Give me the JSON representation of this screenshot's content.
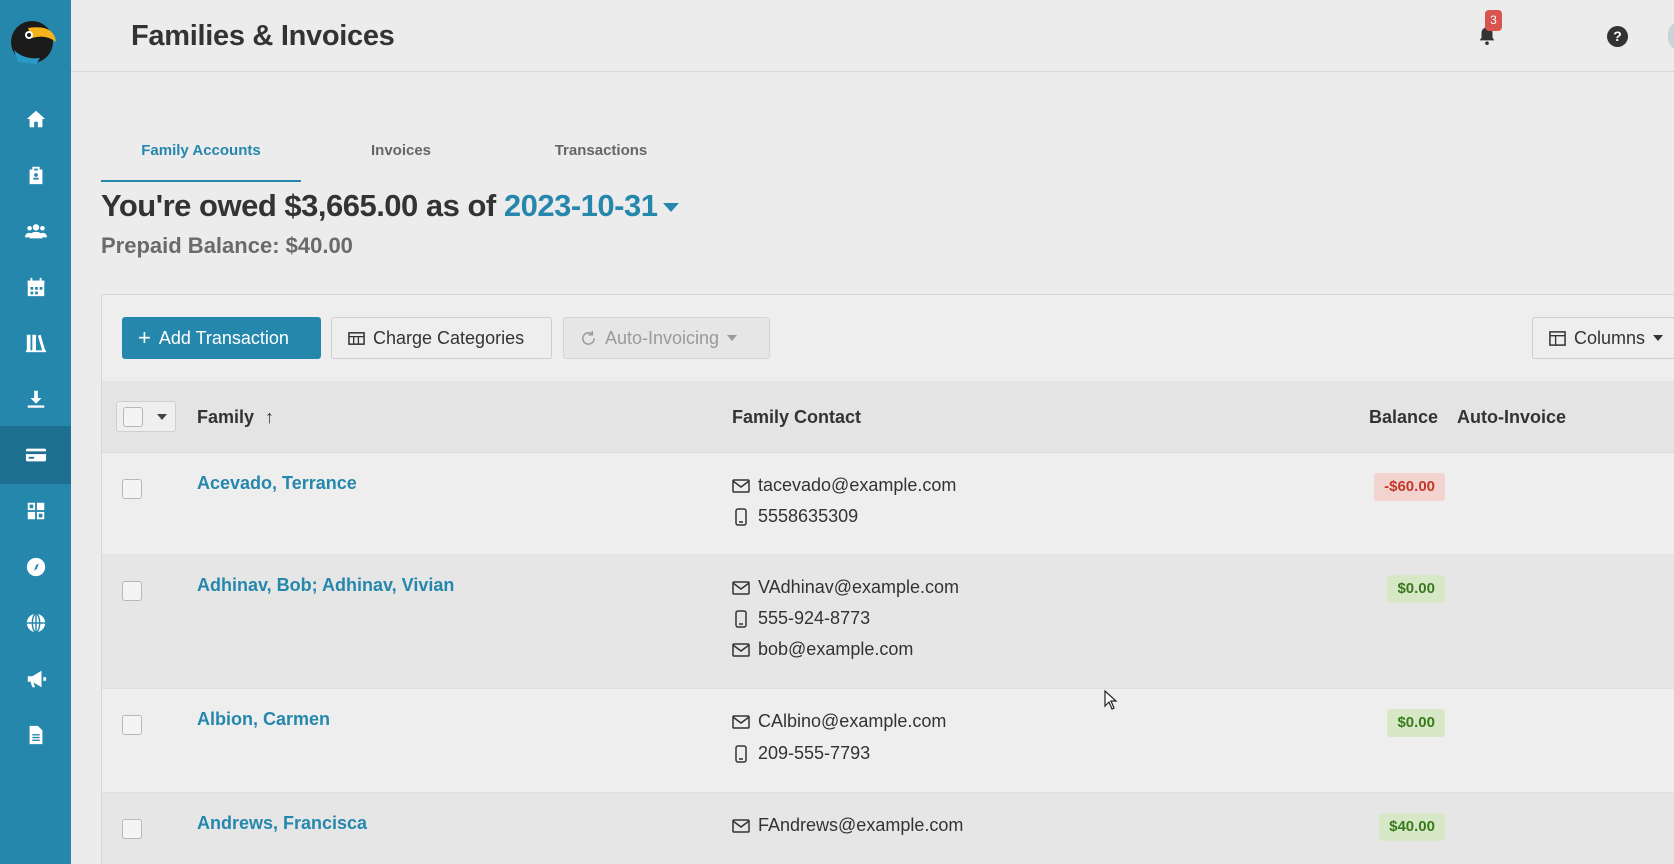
{
  "header": {
    "title": "Families & Invoices",
    "notification_count": "3",
    "help_label": "?"
  },
  "sidebar": {
    "items": [
      {
        "icon": "home-icon"
      },
      {
        "icon": "clipboard-icon"
      },
      {
        "icon": "users-icon"
      },
      {
        "icon": "calendar-icon"
      },
      {
        "icon": "library-icon"
      },
      {
        "icon": "download-icon"
      },
      {
        "icon": "credit-card-icon",
        "active": true
      },
      {
        "icon": "grid-icon"
      },
      {
        "icon": "compass-icon"
      },
      {
        "icon": "globe-icon"
      },
      {
        "icon": "megaphone-icon"
      },
      {
        "icon": "document-icon"
      }
    ]
  },
  "tabs": [
    {
      "label": "Family Accounts",
      "active": true
    },
    {
      "label": "Invoices"
    },
    {
      "label": "Transactions"
    }
  ],
  "summary": {
    "owed_prefix": "You're owed $3,665.00 as of",
    "date": "2023-10-31",
    "prepaid": "Prepaid Balance: $40.00"
  },
  "toolbar": {
    "add_transaction": "Add Transaction",
    "charge_categories": "Charge Categories",
    "auto_invoicing": "Auto-Invoicing",
    "columns": "Columns"
  },
  "table": {
    "columns": {
      "family": "Family",
      "contact": "Family Contact",
      "balance": "Balance",
      "auto_invoice": "Auto-Invoice"
    },
    "rows": [
      {
        "family": "Acevado, Terrance",
        "contacts": [
          {
            "type": "email",
            "value": "tacevado@example.com"
          },
          {
            "type": "phone",
            "value": "5558635309"
          }
        ],
        "balance": "-$60.00",
        "status": "negative"
      },
      {
        "family": "Adhinav, Bob; Adhinav, Vivian",
        "contacts": [
          {
            "type": "email",
            "value": "VAdhinav@example.com"
          },
          {
            "type": "phone",
            "value": "555-924-8773"
          },
          {
            "type": "email",
            "value": "bob@example.com"
          }
        ],
        "balance": "$0.00",
        "status": "positive"
      },
      {
        "family": "Albion, Carmen",
        "contacts": [
          {
            "type": "email",
            "value": "CAlbino@example.com"
          },
          {
            "type": "phone",
            "value": "209-555-7793"
          }
        ],
        "balance": "$0.00",
        "status": "positive"
      },
      {
        "family": "Andrews, Francisca",
        "contacts": [
          {
            "type": "email",
            "value": "FAndrews@example.com"
          }
        ],
        "balance": "$40.00",
        "status": "positive"
      }
    ]
  },
  "colors": {
    "accent": "#2687ad",
    "sidebar": "#2687ad",
    "negative": "#c0392b",
    "positive": "#3a7a1f"
  }
}
